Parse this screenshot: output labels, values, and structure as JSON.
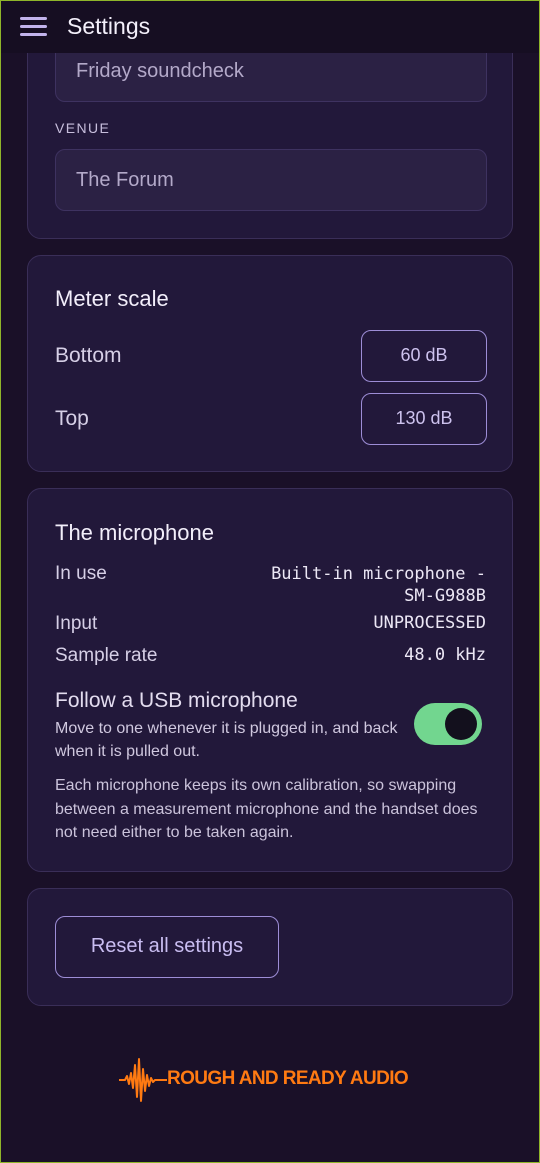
{
  "appbar": {
    "title": "Settings",
    "menu_icon": "hamburger-menu-icon"
  },
  "event_card": {
    "name_value": "Friday soundcheck",
    "venue_caption": "VENUE",
    "venue_value": "The Forum"
  },
  "meter_scale": {
    "title": "Meter scale",
    "bottom_label": "Bottom",
    "bottom_value": "60 dB",
    "top_label": "Top",
    "top_value": "130 dB"
  },
  "microphone": {
    "title": "The microphone",
    "in_use_label": "In use",
    "in_use_value_line1": "Built-in microphone -",
    "in_use_value_line2": "SM-G988B",
    "input_label": "Input",
    "input_value": "UNPROCESSED",
    "sample_rate_label": "Sample rate",
    "sample_rate_value": "48.0 kHz",
    "follow_usb_title": "Follow a USB microphone",
    "follow_usb_description": "Move to one whenever it is plugged in, and back when it is pulled out.",
    "follow_usb_enabled": true,
    "calibration_note": "Each microphone keeps its own calibration, so swapping between a measurement microphone and the handset does not need either to be taken again."
  },
  "reset": {
    "label": "Reset all settings"
  },
  "footer": {
    "logo_text": "ROUGH AND READY AUDIO",
    "logo_color": "#ff7a12",
    "logo_icon": "waveform-icon"
  },
  "colors": {
    "background": "#1a1028",
    "card": "#22183a",
    "accent": "#9d8dd6",
    "toggle_on": "#72d68f"
  }
}
